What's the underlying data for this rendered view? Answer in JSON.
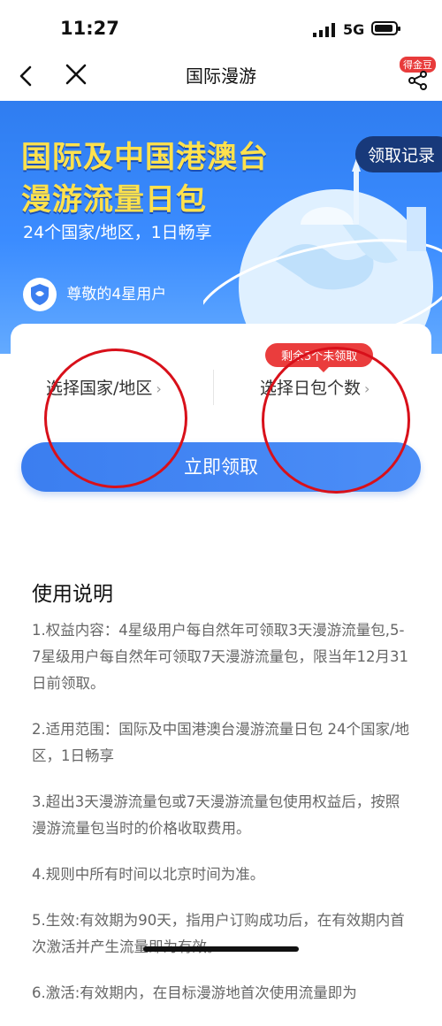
{
  "status": {
    "time": "11:27",
    "network": "5G"
  },
  "nav": {
    "title": "国际漫游",
    "gold_badge": "得金豆"
  },
  "banner": {
    "title_line1": "国际及中国港澳台",
    "title_line2": "漫游流量日包",
    "subtitle": "24个国家/地区，1日畅享",
    "record_button": "领取记录",
    "user_level": "尊敬的4星用户"
  },
  "selector": {
    "country_label": "选择国家/地区",
    "package_label": "选择日包个数",
    "remaining_badge": "剩余3个未领取"
  },
  "claim_button": "立即领取",
  "instructions": {
    "title": "使用说明",
    "items": [
      "1.权益内容：4星级用户每自然年可领取3天漫游流量包,5-7星级用户每自然年可领取7天漫游流量包，限当年12月31日前领取。",
      "2.适用范围：国际及中国港澳台漫游流量日包 24个国家/地区，1日畅享",
      "3.超出3天漫游流量包或7天漫游流量包使用权益后，按照漫游流量包当时的价格收取费用。",
      "4.规则中所有时间以北京时间为准。",
      "5.生效:有效期为90天，指用户订购成功后，在有效期内首次激活并产生流量即为有效。",
      "6.激活:有效期内，在目标漫游地首次使用流量即为"
    ]
  },
  "colors": {
    "banner": "#3b8cff",
    "title_yellow": "#ffe14d",
    "accent_red": "#d8101a",
    "button_blue": "#3b7ef0"
  }
}
